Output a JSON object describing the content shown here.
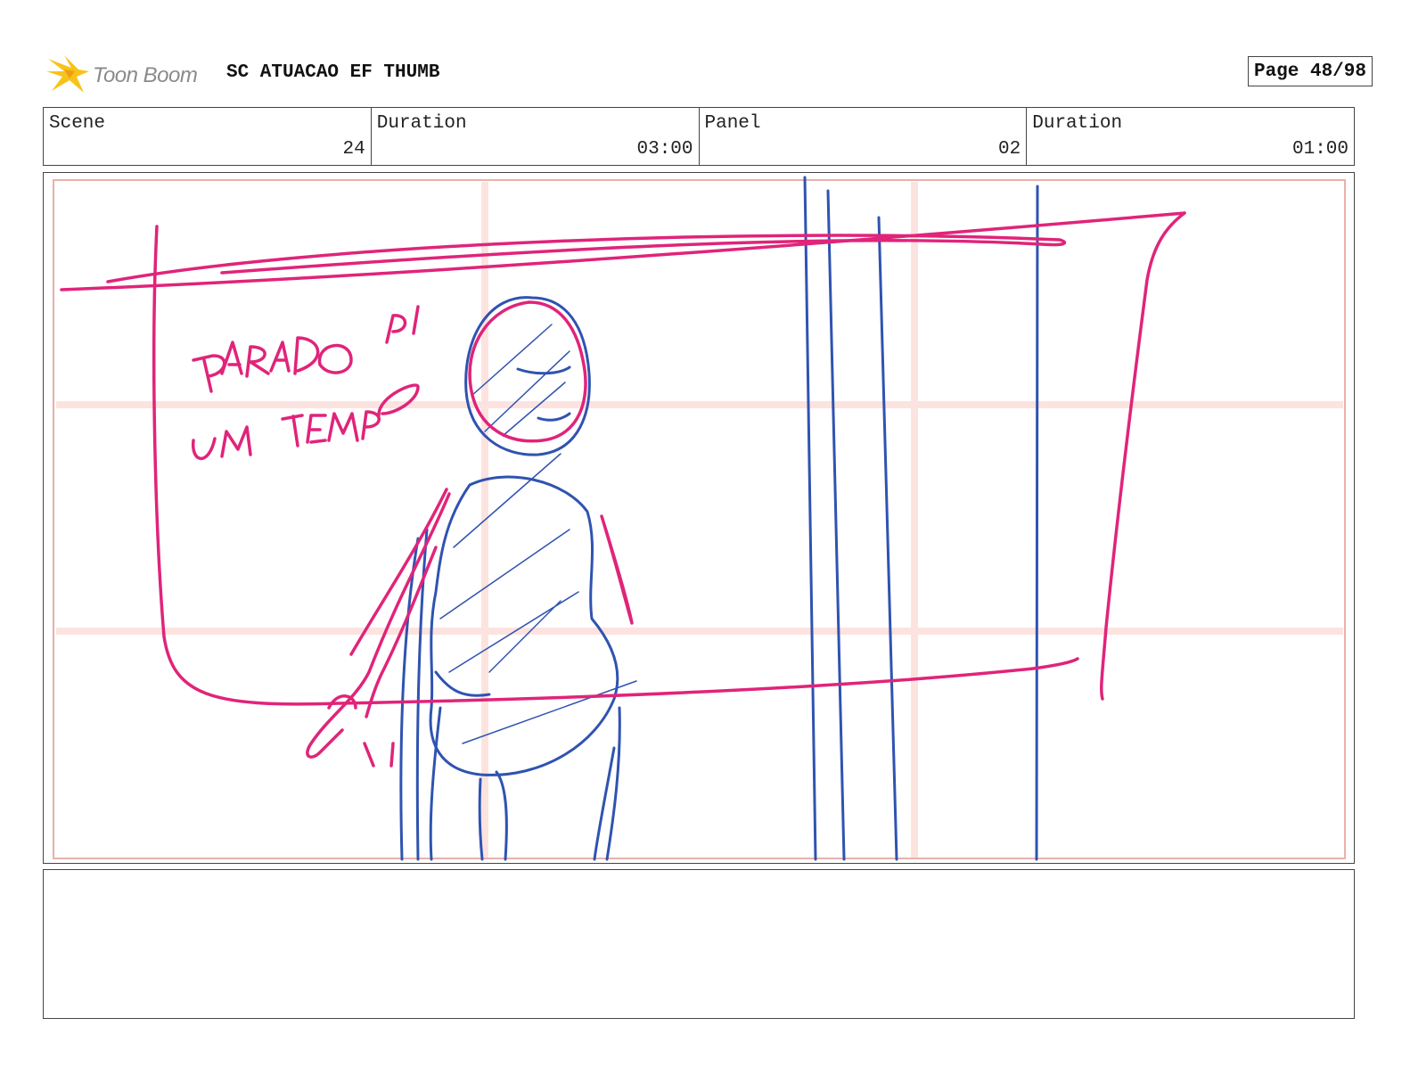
{
  "header": {
    "logo_text": "Toon Boom",
    "title": "SC ATUACAO EF THUMB",
    "page": "Page 48/98"
  },
  "info": {
    "scene_label": "Scene",
    "scene_value": "24",
    "scene_duration_label": "Duration",
    "scene_duration_value": "03:00",
    "panel_label": "Panel",
    "panel_value": "02",
    "panel_duration_label": "Duration",
    "panel_duration_value": "01:00"
  },
  "sketch": {
    "annotation_line1": "PARADO P/",
    "annotation_line2": "UM TEMPO",
    "colors": {
      "magenta": "#e0247a",
      "blue": "#2f53b0",
      "guide": "#fde3df"
    }
  },
  "notes": {
    "text": ""
  }
}
